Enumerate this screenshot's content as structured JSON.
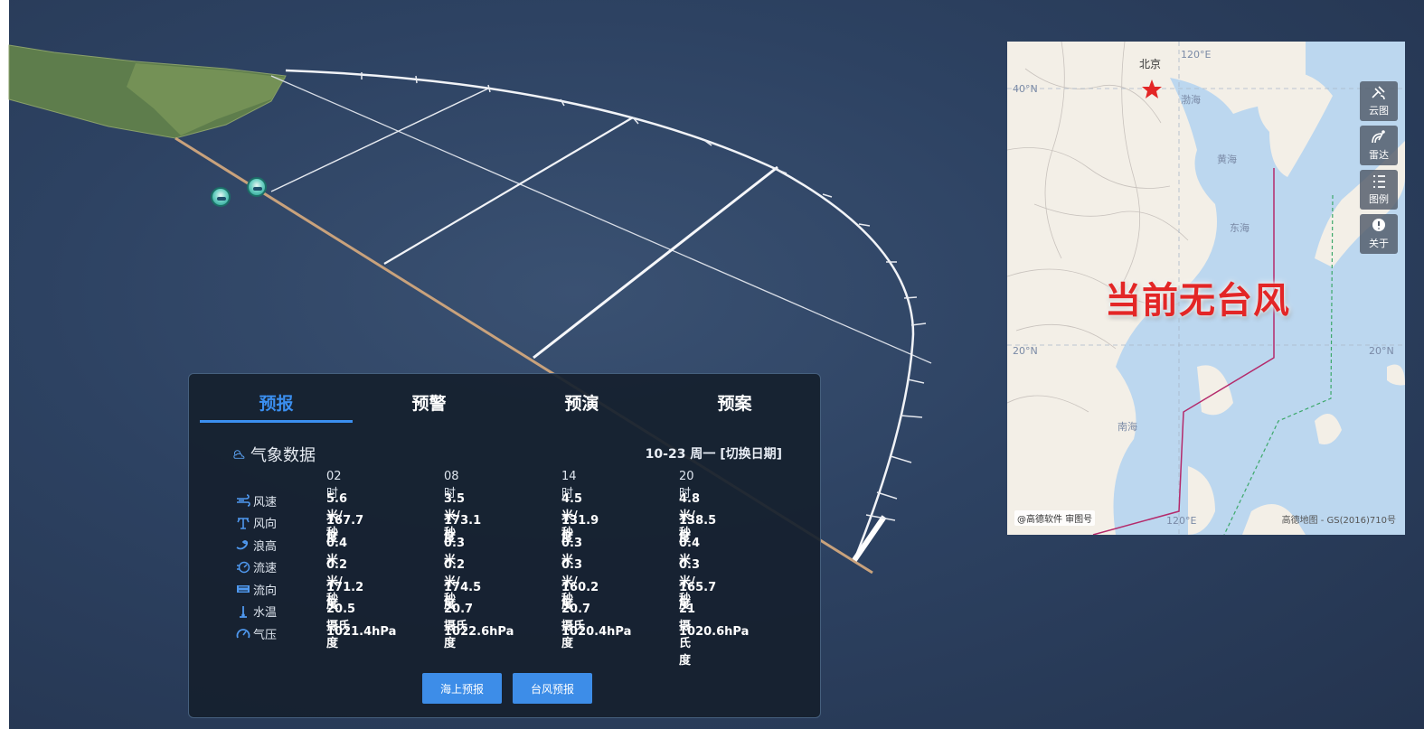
{
  "tabs": [
    "预报",
    "预警",
    "预演",
    "预案"
  ],
  "active_tab": "预报",
  "weather": {
    "title": "气象数据",
    "date_link": "10-23 周一 [切换日期]",
    "times": [
      "02时",
      "08时",
      "14时",
      "20时"
    ],
    "rows": [
      {
        "label": "风速",
        "icon": "wind-icon",
        "values": [
          "5.6米/秒",
          "3.5米/秒",
          "4.5米/秒",
          "4.8米/秒"
        ]
      },
      {
        "label": "风向",
        "icon": "wind-direction-icon",
        "values": [
          "167.7度",
          "173.1度",
          "131.9度",
          "138.5度"
        ]
      },
      {
        "label": "浪高",
        "icon": "wave-icon",
        "values": [
          "0.4米",
          "0.3米",
          "0.3米",
          "0.4米"
        ]
      },
      {
        "label": "流速",
        "icon": "current-speed-icon",
        "values": [
          "0.2米/秒",
          "0.2米/秒",
          "0.3米/秒",
          "0.3米/秒"
        ]
      },
      {
        "label": "流向",
        "icon": "current-direction-icon",
        "values": [
          "171.2度",
          "174.5度",
          "160.2度",
          "165.7度"
        ]
      },
      {
        "label": "水温",
        "icon": "thermometer-icon",
        "values": [
          "20.5摄氏度",
          "20.7摄氏度",
          "20.7摄氏度",
          "21摄氏度"
        ]
      },
      {
        "label": "气压",
        "icon": "gauge-icon",
        "values": [
          "1021.4hPa",
          "1022.6hPa",
          "1020.4hPa",
          "1020.6hPa"
        ]
      }
    ]
  },
  "buttons": {
    "sea_forecast": "海上预报",
    "typhoon_forecast": "台风预报"
  },
  "map": {
    "banner": "当前无台风",
    "city": "北京",
    "grid_labels": {
      "lon_top": "120°E",
      "lat_40": "40°N",
      "lat_20_left": "20°N",
      "lat_20_right": "20°N",
      "lon_bottom": "120°E"
    },
    "sea_labels": {
      "bohai": "渤海",
      "huanghai": "黄海",
      "donghai": "东海",
      "nanhai": "南海"
    },
    "footer_left": "@高德软件 审图号",
    "footer_right": "高德地图 - GS(2016)710号",
    "tools": [
      "云图",
      "雷达",
      "图例",
      "关于"
    ]
  },
  "colors": {
    "accent": "#3b8ff0",
    "banner": "#e32626",
    "panel_bg": "#16202e",
    "button": "#3d8de8"
  }
}
